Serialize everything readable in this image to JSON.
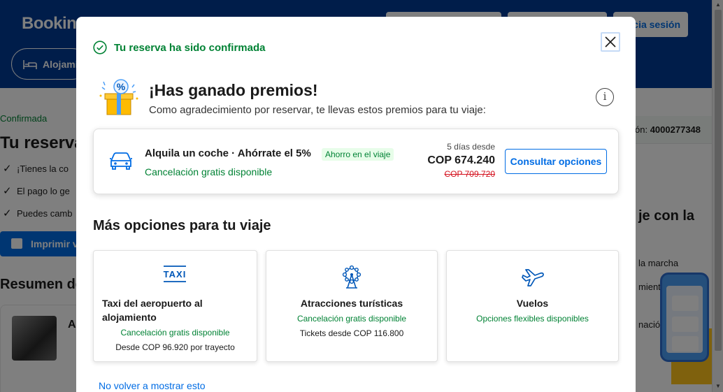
{
  "background": {
    "logo": "Bookin",
    "top_btn_right": "cia sesión",
    "nav_pill": "Alojami",
    "confirmed": "Confirmada",
    "title": "Tu reserva",
    "checks": [
      "¡Tienes la co",
      "El pago lo ge",
      "Puedes camb"
    ],
    "print_btn": "Imprimir v",
    "resumen": "Resumen de",
    "card_letter": "A",
    "res_label": "ón:",
    "res_number": "4000277348",
    "right_title": "je con la",
    "right_lines": [
      "la marcha",
      "miento en",
      "nación offline"
    ]
  },
  "modal": {
    "confirm_text": "Tu reserva ha sido confirmada",
    "prize_title": "¡Has ganado premios!",
    "prize_subtitle": "Como agradecimiento por reservar, te llevas estos premios para tu viaje:",
    "gift_percent": "%",
    "car": {
      "title": "Alquila un coche · Ahórrate el 5%",
      "badge": "Ahorro en el viaje",
      "cancel": "Cancelación gratis disponible",
      "from": "5 días desde",
      "price": "COP 674.240",
      "old_price": "COP 709.720",
      "button": "Consultar opciones"
    },
    "more_title": "Más opciones para tu viaje",
    "options": [
      {
        "icon": "taxi-icon",
        "icon_text": "TAXI",
        "title": "Taxi del aeropuerto al alojamiento",
        "green": "Cancelación gratis disponible",
        "gray": "Desde COP 96.920 por trayecto"
      },
      {
        "icon": "ferris-wheel-icon",
        "title": "Atracciones turísticas",
        "green": "Cancelación gratis disponible",
        "gray": "Tickets desde COP 116.800"
      },
      {
        "icon": "plane-icon",
        "title": "Vuelos",
        "green": "Opciones flexibles disponibles",
        "gray": ""
      }
    ],
    "no_show": "No volver a mostrar esto"
  },
  "colors": {
    "brand_blue": "#003b95",
    "link_blue": "#006ce4",
    "green": "#008234",
    "red": "#d4111e"
  }
}
